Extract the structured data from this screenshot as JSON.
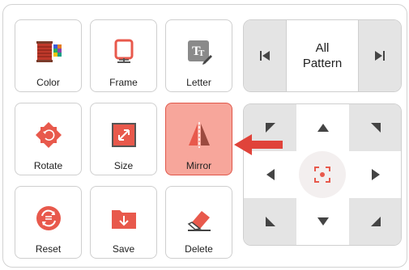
{
  "tools": {
    "color": "Color",
    "frame": "Frame",
    "letter": "Letter",
    "rotate": "Rotate",
    "size": "Size",
    "mirror": "Mirror",
    "reset": "Reset",
    "save": "Save",
    "delete": "Delete"
  },
  "active_tool": "mirror",
  "pattern_nav": {
    "title": "All\nPattern"
  },
  "colors": {
    "accent": "#e8594c",
    "active_bg": "#f7a69b",
    "button_bg": "#e4e4e4",
    "arrow": "#444444"
  }
}
